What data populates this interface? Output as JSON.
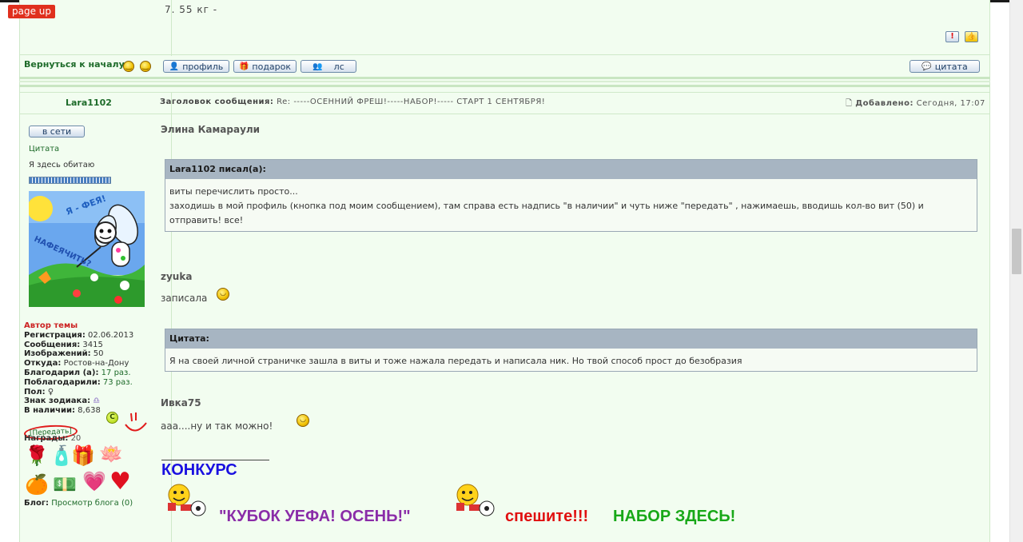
{
  "page_up": "page up",
  "previous_post": {
    "text": "7. 55 кг -",
    "report_icon": "!",
    "thumb_icon": "👍"
  },
  "footer_bar": {
    "back_to_top": "Вернуться к началу",
    "profile": "профиль",
    "gift": "подарок",
    "pm": "лс",
    "quote": "цитата"
  },
  "post": {
    "author": "Lara1102",
    "title_label": "Заголовок сообщения:",
    "title": "Re: -----ОСЕННИЙ ФРЕШ!-----НАБОР!----- СТАРТ 1 СЕНТЯБРЯ!",
    "added_label": "Добавлено:",
    "added": "Сегодня, 17:07"
  },
  "sidebar": {
    "online": "в сети",
    "quote_link": "Цитата",
    "status": "Я здесь обитаю",
    "author_badge": "Автор темы",
    "stats": [
      {
        "k": "Регистрация:",
        "v": "02.06.2013",
        "green": false
      },
      {
        "k": "Сообщения:",
        "v": "3415",
        "green": false
      },
      {
        "k": "Изображений:",
        "v": "50",
        "green": false
      },
      {
        "k": "Откуда:",
        "v": "Ростов-на-Дону",
        "green": false
      },
      {
        "k": "Благодарил (а):",
        "v": "17 раз.",
        "green": true
      },
      {
        "k": "Поблагодарили:",
        "v": "73 раз.",
        "green": true
      },
      {
        "k": "Пол:",
        "v": "♀",
        "green": false
      },
      {
        "k": "Знак зодиака:",
        "v": "",
        "green": false
      },
      {
        "k": "В наличии:",
        "v": "8,638",
        "green": false
      }
    ],
    "transfer": "[Передать]",
    "awards_label": "Награды:",
    "awards_count": "20",
    "blog_label": "Блог:",
    "blog_link": "Просмотр блога (0)",
    "coin": "C",
    "avatar": {
      "text1": "Я - ФЕЯ!",
      "text2": "НАФЕЯЧИТЬ?"
    }
  },
  "content": {
    "name1": "Элина Камараули",
    "quote1": {
      "head": "Lara1102 писал(а):",
      "line1": "виты перечислить просто...",
      "line2": "заходишь в мой профиль (кнопка под моим сообщением), там справа есть надпись \"в наличии\" и чуть ниже \"передать\" , нажимаешь, вводишь кол-во вит (50) и",
      "line3": "отправить! все!"
    },
    "name2": "zyuka",
    "text2": "записала",
    "quote2": {
      "head": "Цитата:",
      "line1": "Я на своей личной страничке зашла в виты и тоже нажала передать и написала ник. Но твой способ прост до безобразия"
    },
    "name3": "Ивка75",
    "text3": "ааа....ну и так можно!",
    "konkurs": "КОНКУРС",
    "cup": "\"КУБОК УЕФА! ОСЕНЬ!\"",
    "hurry": "спешите!!!",
    "here": "НАБОР ЗДЕСЬ!"
  },
  "colors": {
    "forum_bg": "#f2fdf0",
    "link_green": "#1e6b2a",
    "quote_head": "#a7b5c2",
    "konkurs_blue": "#1a10e0"
  }
}
